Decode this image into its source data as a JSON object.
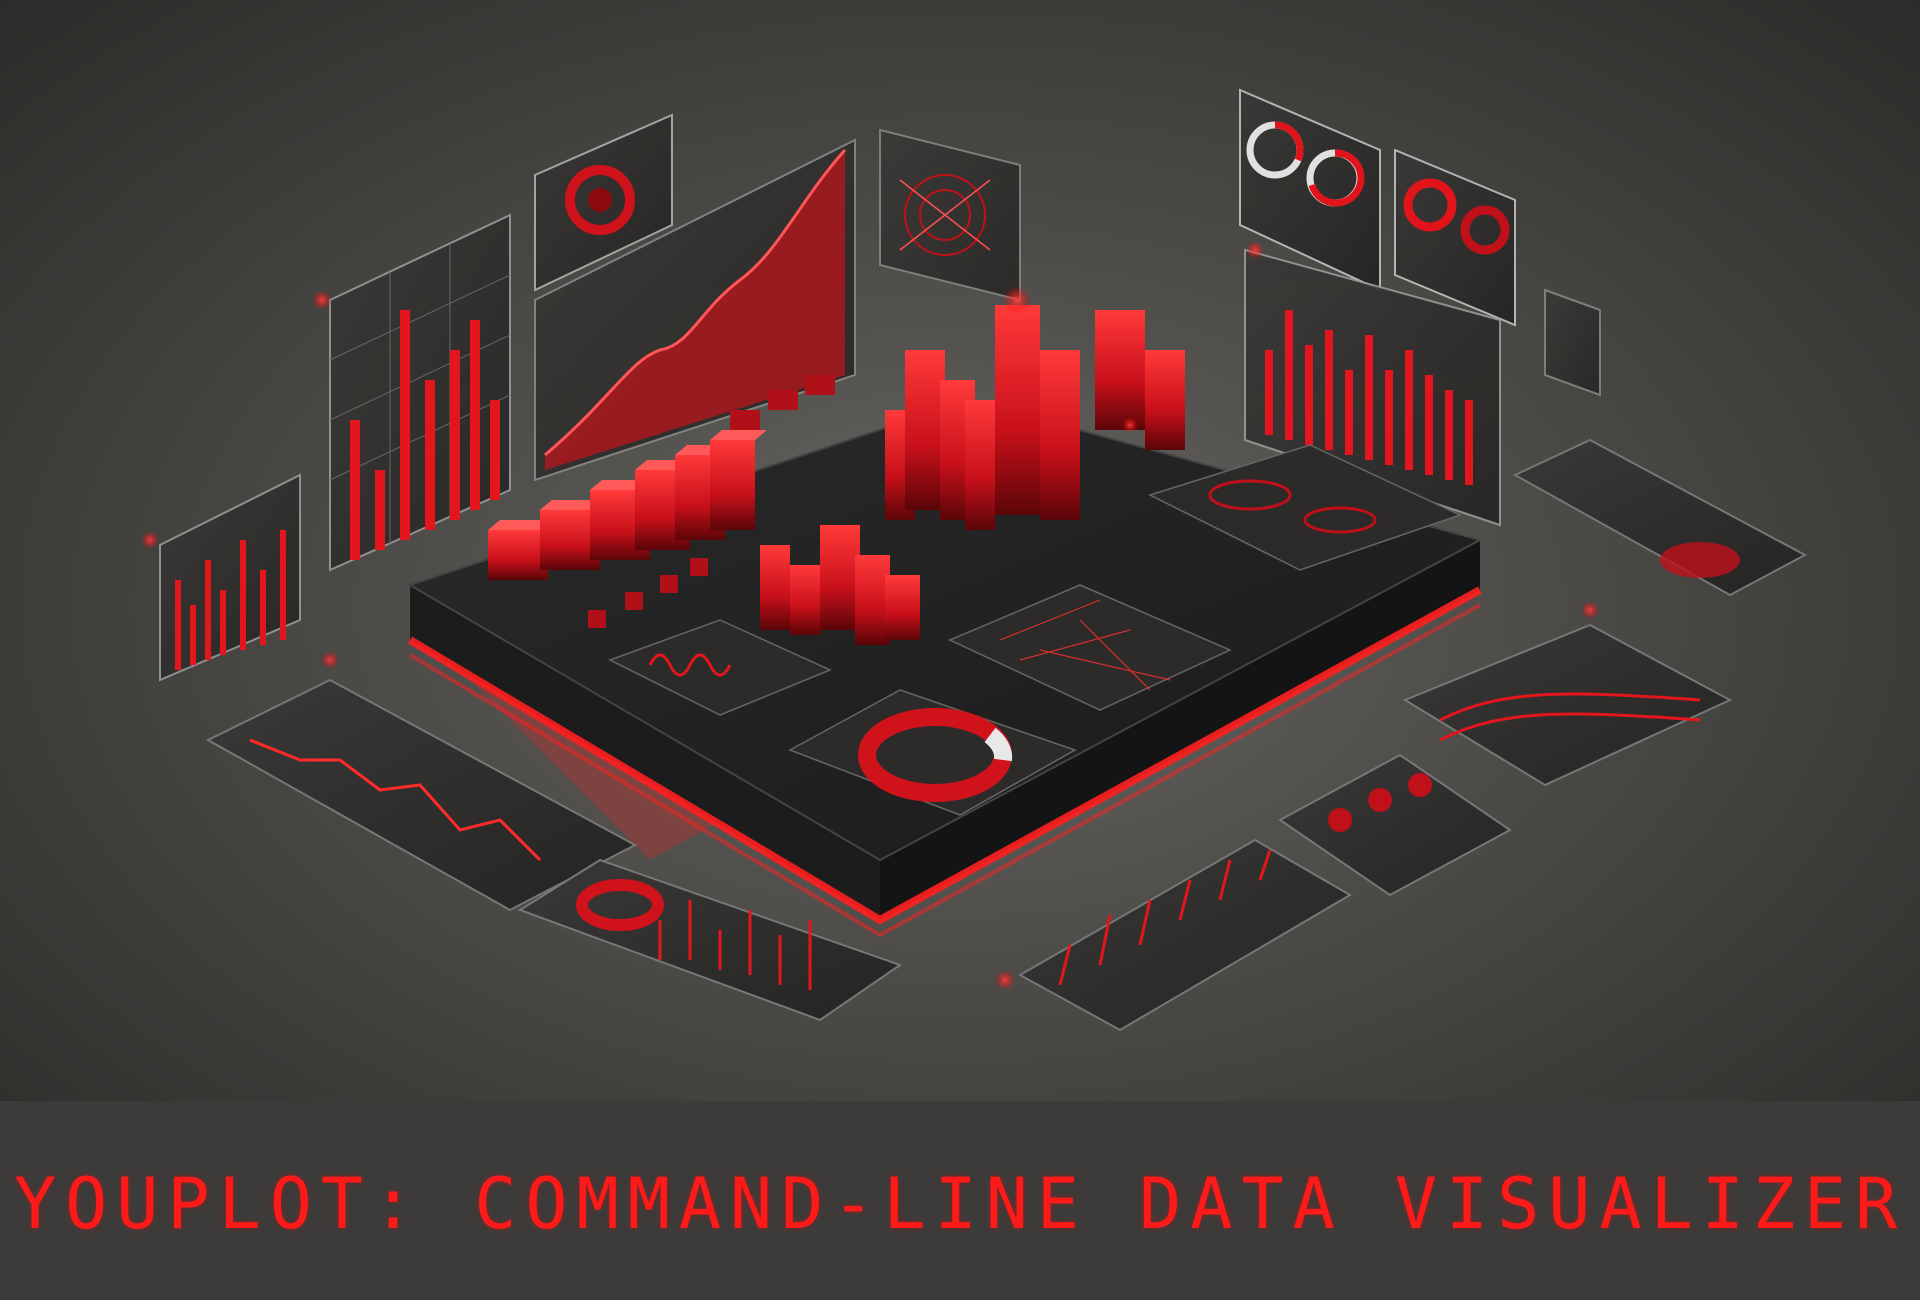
{
  "banner": {
    "title": "YOUPLOT: COMMAND-LINE DATA VISUALIZER"
  },
  "illustration": {
    "theme_color": "#e8141a",
    "glow_color": "#ff2020",
    "background_color": "#4a4946"
  }
}
